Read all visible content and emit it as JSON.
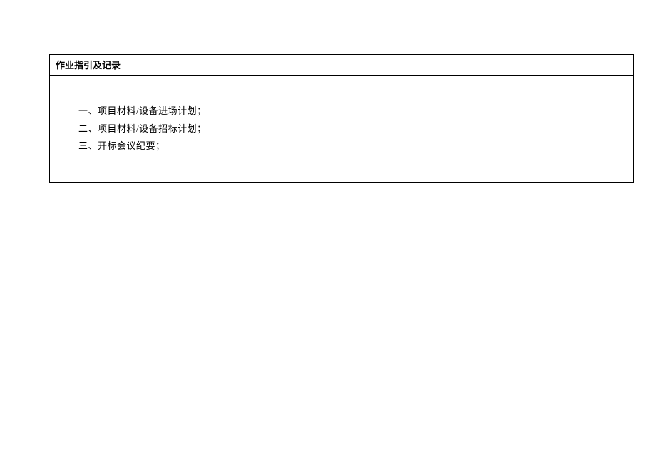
{
  "document": {
    "title": "作业指引及记录",
    "items": [
      "一、项目材料/设备进场计划；",
      "二、项目材料/设备招标计划；",
      "三、开标会议纪要；"
    ]
  }
}
